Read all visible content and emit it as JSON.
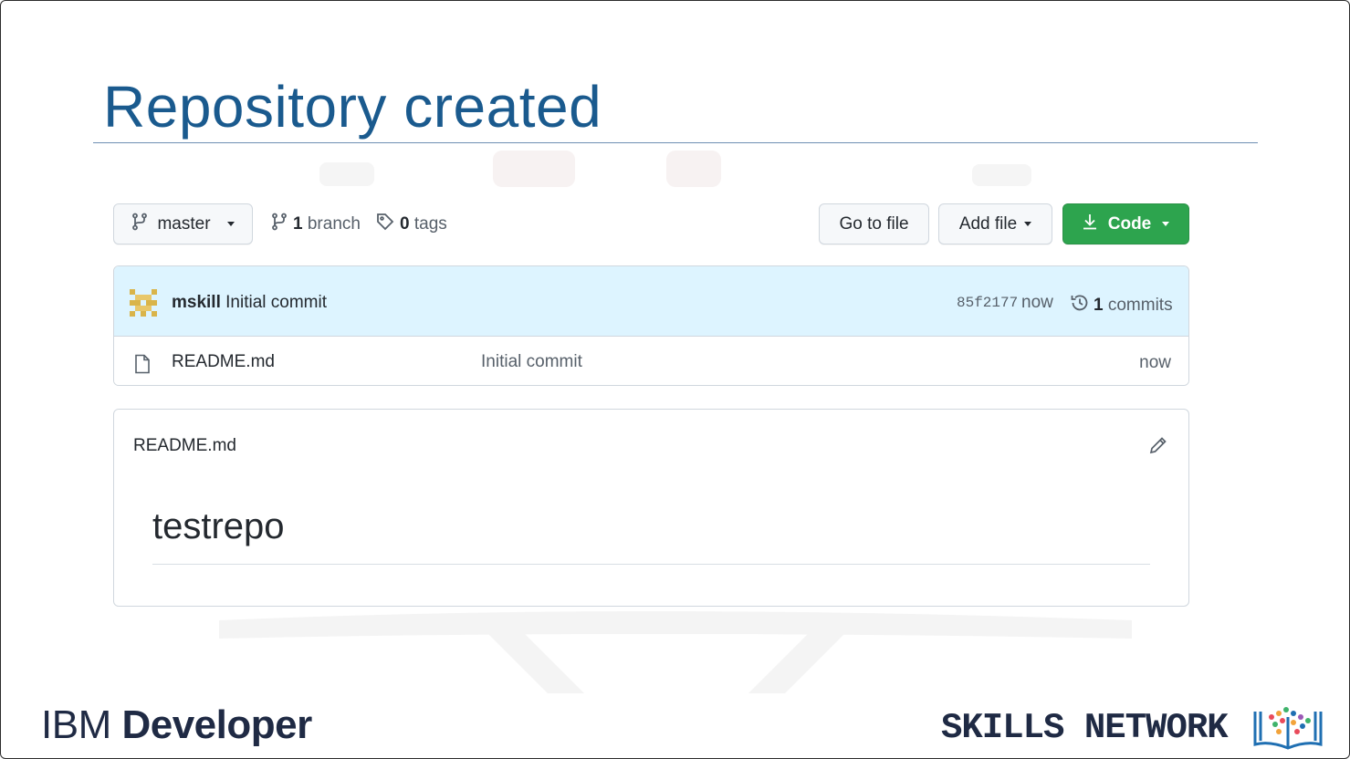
{
  "slide": {
    "title": "Repository created"
  },
  "toolbar": {
    "branch": "master",
    "branch_count": "1",
    "branch_label": "branch",
    "tag_count": "0",
    "tag_label": "tags",
    "goto_file": "Go to file",
    "add_file": "Add file",
    "code": "Code"
  },
  "latest_commit": {
    "author": "mskill",
    "message": "Initial commit",
    "sha": "85f2177",
    "time": "now",
    "commit_count": "1",
    "commits_label": "commits"
  },
  "files": [
    {
      "name": "README.md",
      "message": "Initial commit",
      "time": "now"
    }
  ],
  "readme": {
    "filename": "README.md",
    "heading": "testrepo"
  },
  "footer": {
    "ibm_light": "IBM",
    "ibm_bold": "Developer",
    "skills": "SKILLS NETWORK"
  },
  "colors": {
    "title": "#1a5a8e",
    "code_button": "#2da44e",
    "commit_row": "#ddf4ff"
  }
}
